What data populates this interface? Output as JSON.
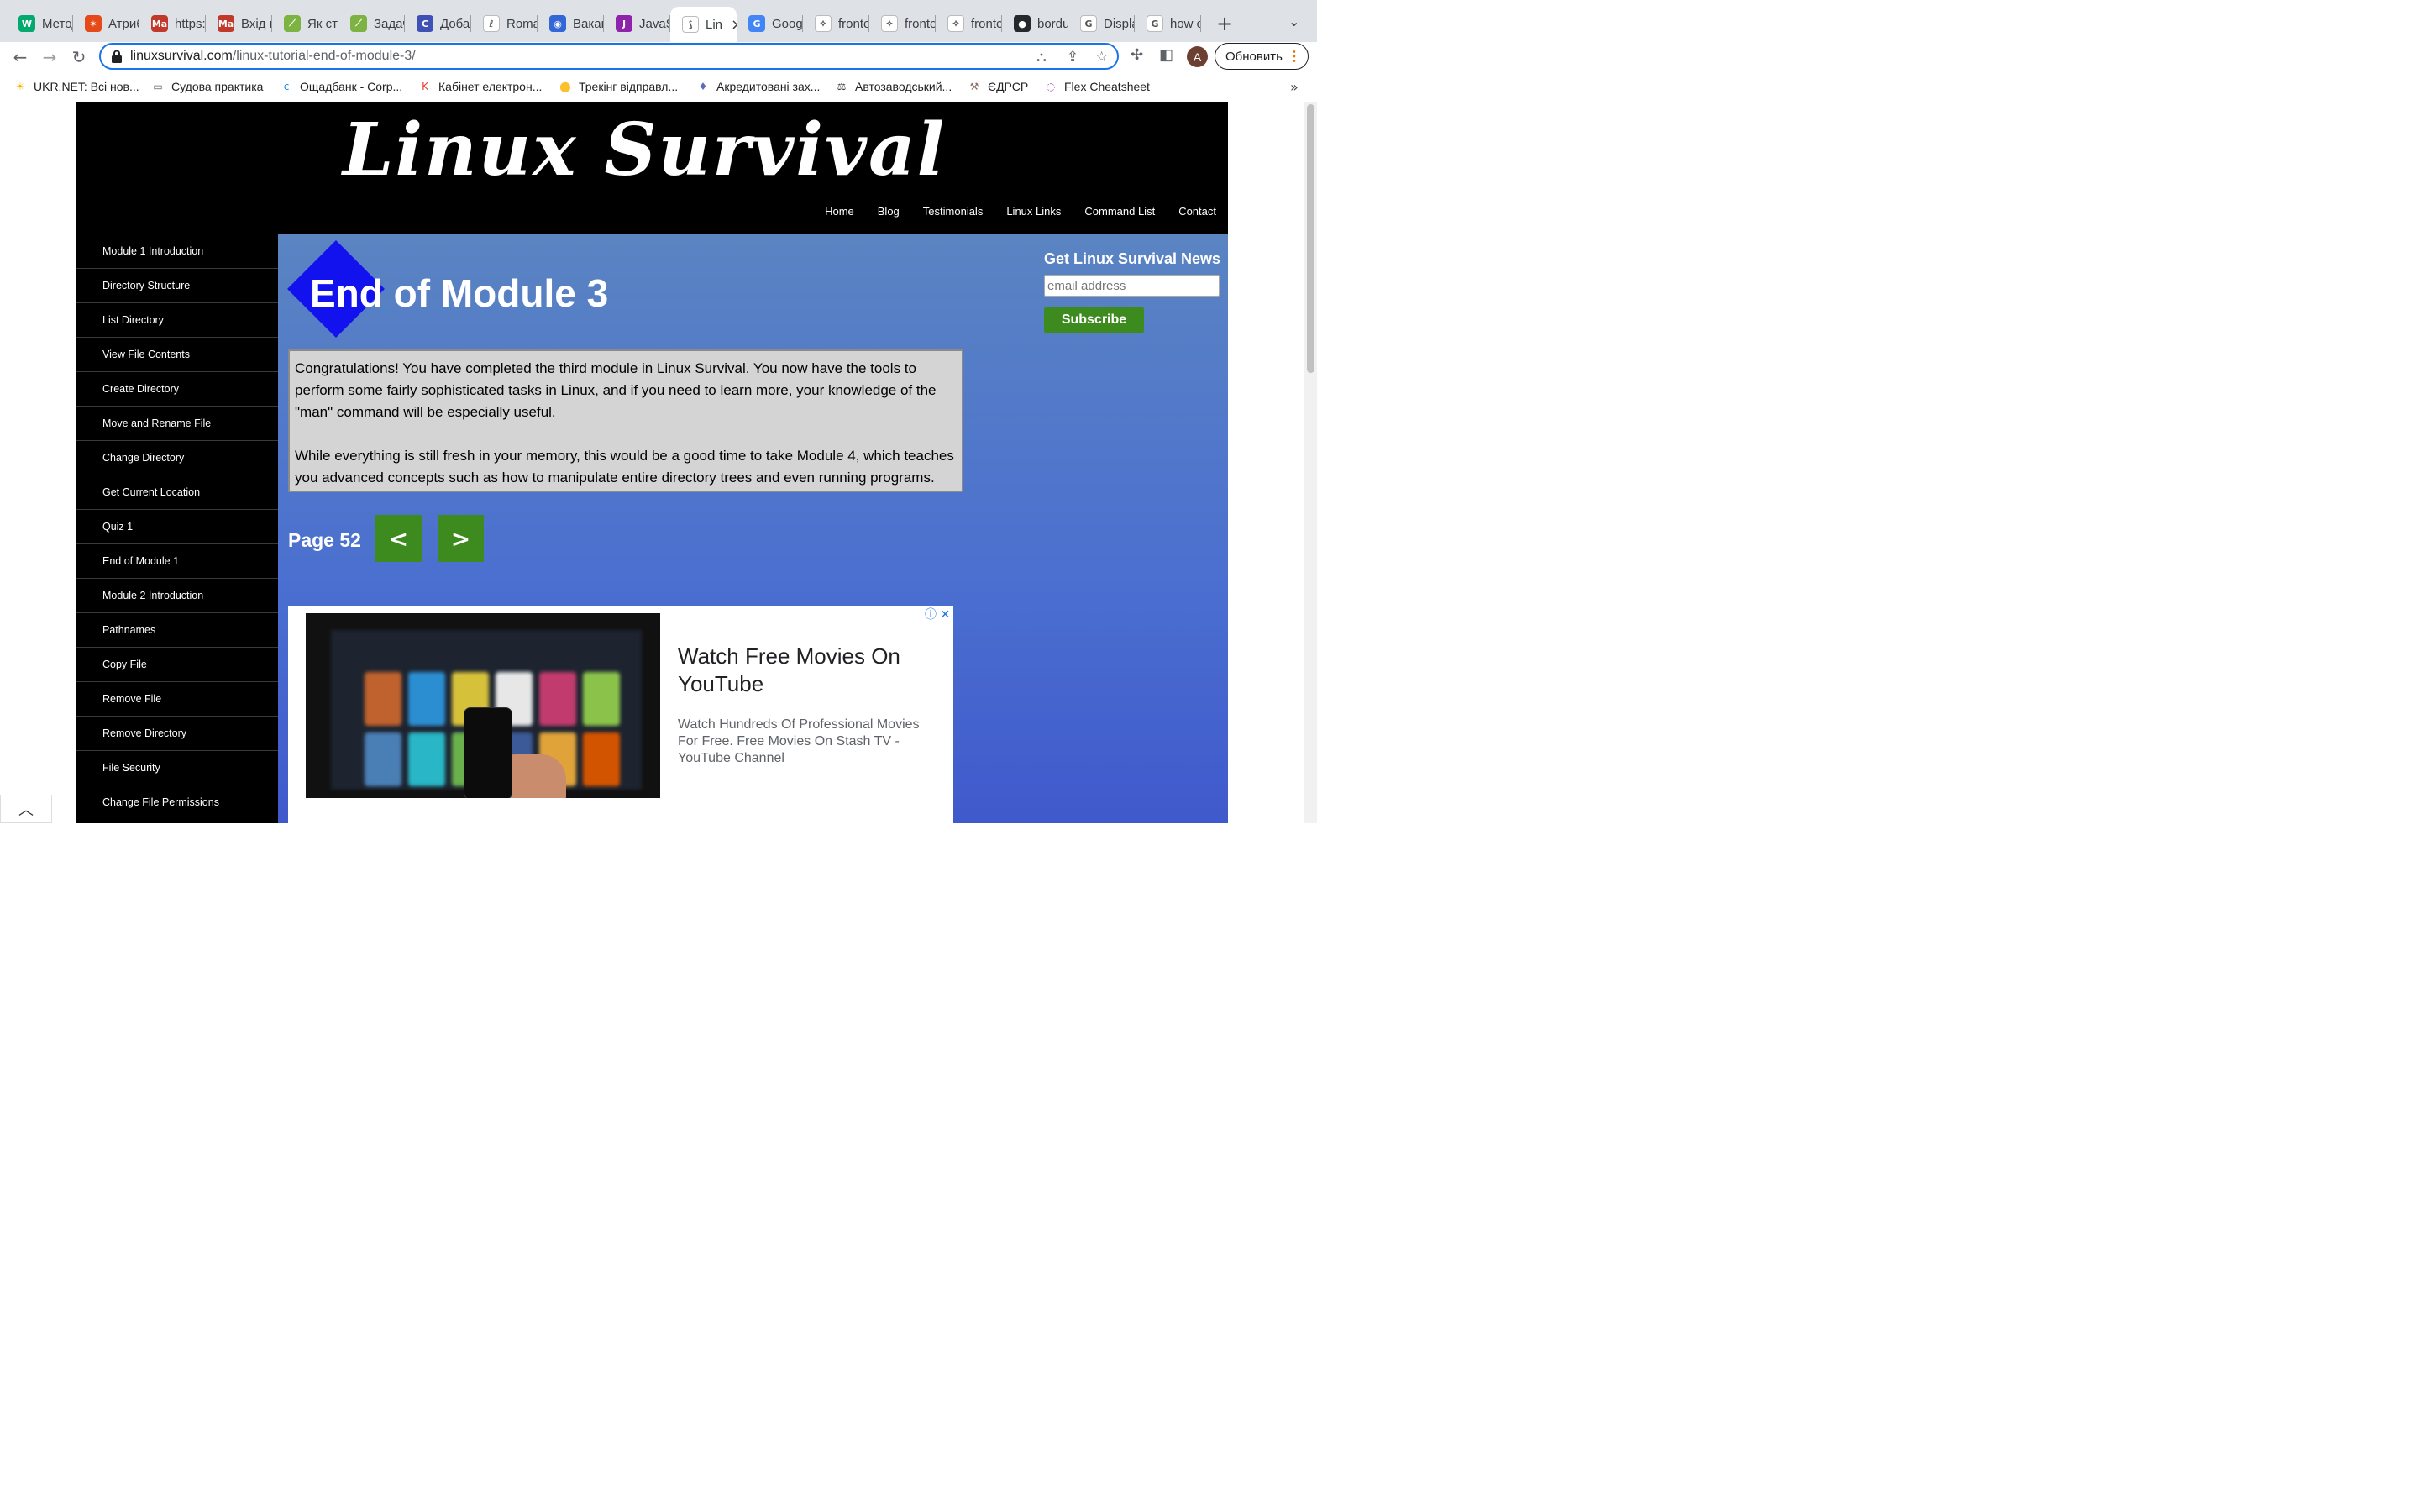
{
  "browser": {
    "tabs": [
      {
        "title": "Метод",
        "fav_text": "W",
        "fav_color": "#04aa6d",
        "active": false
      },
      {
        "title": "Атрибу",
        "fav_text": "✶",
        "fav_color": "#e64a19",
        "active": false
      },
      {
        "title": "https:",
        "fav_text": "Ma",
        "fav_color": "#c0392b",
        "active": false
      },
      {
        "title": "Вхід в",
        "fav_text": "Ma",
        "fav_color": "#c0392b",
        "active": false
      },
      {
        "title": "Як ств",
        "fav_text": "⟋",
        "fav_color": "#7cb342",
        "active": false
      },
      {
        "title": "Задач",
        "fav_text": "⟋",
        "fav_color": "#7cb342",
        "active": false
      },
      {
        "title": "Добав",
        "fav_text": "C",
        "fav_color": "#3f51b5",
        "active": false
      },
      {
        "title": "Roma",
        "fav_text": "ℓ",
        "fav_color": "#ffffff",
        "active": false
      },
      {
        "title": "Вакан",
        "fav_text": "◉",
        "fav_color": "#3367d6",
        "active": false
      },
      {
        "title": "JavaS",
        "fav_text": "J",
        "fav_color": "#8e24aa",
        "active": false
      },
      {
        "title": "Lin",
        "fav_text": "⟆",
        "fav_color": "#ffffff",
        "active": true
      },
      {
        "title": "Googl",
        "fav_text": "G",
        "fav_color": "#4285f4",
        "active": false
      },
      {
        "title": "fronte",
        "fav_text": "⟡",
        "fav_color": "#ffffff",
        "active": false
      },
      {
        "title": "fronte",
        "fav_text": "⟡",
        "fav_color": "#ffffff",
        "active": false
      },
      {
        "title": "fronte",
        "fav_text": "⟡",
        "fav_color": "#ffffff",
        "active": false
      },
      {
        "title": "bordu",
        "fav_text": "●",
        "fav_color": "#24292e",
        "active": false
      },
      {
        "title": "Displa",
        "fav_text": "G",
        "fav_color": "#ffffff",
        "active": false
      },
      {
        "title": "how c",
        "fav_text": "G",
        "fav_color": "#ffffff",
        "active": false
      }
    ],
    "url_domain": "linuxsurvival.com",
    "url_path": "/linux-tutorial-end-of-module-3/",
    "avatar_letter": "A",
    "update_label": "Обновить",
    "bookmarks": [
      {
        "label": "UKR.NET: Всі нов...",
        "icon": "ukrnet-icon",
        "glyph": "☀",
        "color": "#f4b400"
      },
      {
        "label": "Судова практика",
        "icon": "folder-icon",
        "glyph": "▭",
        "color": "#5f6368"
      },
      {
        "label": "Ощадбанк - Corp...",
        "icon": "oschadbank-icon",
        "glyph": "c",
        "color": "#1e88e5"
      },
      {
        "label": "Кабінет електрон...",
        "icon": "tax-cabinet-icon",
        "glyph": "K",
        "color": "#e53935"
      },
      {
        "label": "Трекінг відправл...",
        "icon": "location-pin-icon",
        "glyph": "⬤",
        "color": "#fbc02d"
      },
      {
        "label": "Акредитовані зах...",
        "icon": "microphone-icon",
        "glyph": "♦",
        "color": "#5c6bc0"
      },
      {
        "label": "Автозаводський...",
        "icon": "court-icon",
        "glyph": "⚖",
        "color": "#424242"
      },
      {
        "label": "ЄДРСР",
        "icon": "gavel-icon",
        "glyph": "⚒",
        "color": "#8d6e63"
      },
      {
        "label": "Flex Cheatsheet",
        "icon": "flex-icon",
        "glyph": "◌",
        "color": "#ab47bc"
      }
    ]
  },
  "site": {
    "logo_text": "Linux Survival",
    "nav": [
      "Home",
      "Blog",
      "Testimonials",
      "Linux Links",
      "Command List",
      "Contact"
    ],
    "sidebar": [
      "Module 1 Introduction",
      "Directory Structure",
      "List Directory",
      "View File Contents",
      "Create Directory",
      "Move and Rename File",
      "Change Directory",
      "Get Current Location",
      "Quiz 1",
      "End of Module 1",
      "Module 2 Introduction",
      "Pathnames",
      "Copy File",
      "Remove File",
      "Remove Directory",
      "File Security",
      "Change File Permissions"
    ],
    "page_title": "End of Module 3",
    "paragraphs": [
      "Congratulations! You have completed the third module in Linux Survival. You now have the tools to perform some fairly sophisticated tasks in Linux, and if you need to learn more, your knowledge of the \"man\" command will be especially useful.",
      "While everything is still fresh in your memory, this would be a good time to take Module 4, which teaches you advanced concepts such as how to manipulate entire directory trees and even running programs."
    ],
    "page_label": "Page 52",
    "prev_label": "<",
    "next_label": ">",
    "newsletter": {
      "title": "Get Linux Survival News",
      "email_placeholder": "email address",
      "subscribe_label": "Subscribe"
    },
    "ad": {
      "title": "Watch Free Movies On YouTube",
      "description": "Watch Hundreds Of Professional Movies For Free. Free Movies On Stash TV - YouTube Channel",
      "info_icon": "ⓘ",
      "close_icon": "✕"
    }
  },
  "colors": {
    "header_bg": "#000000",
    "main_gradient_top": "#5a84c2",
    "main_gradient_bottom": "#4059cc",
    "button_green": "#3d8b1f",
    "diamond_blue": "#1212ee",
    "omnibox_focus": "#1a73e8"
  }
}
